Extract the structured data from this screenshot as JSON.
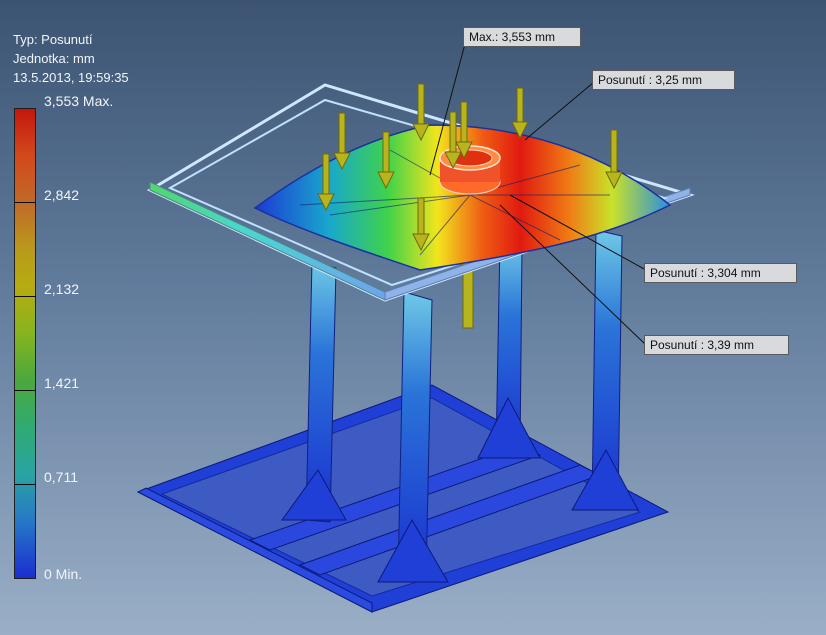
{
  "legend": {
    "type_line": "Typ: Posunutí",
    "unit_line": "Jednotka: mm",
    "timestamp": "13.5.2013, 19:59:35",
    "ticks": [
      "3,553 Max.",
      "2,842",
      "2,132",
      "1,421",
      "0,711",
      "0 Min."
    ],
    "gradient_colors": [
      "#c3170c",
      "#d2491b",
      "#b99a1c",
      "#4aa83e",
      "#2aa3a3",
      "#1b2ed0"
    ]
  },
  "callouts": {
    "max": "Max.: 3,553 mm",
    "probe1": "Posunutí : 3,25 mm",
    "probe2": "Posunutí : 3,304 mm",
    "probe3": "Posunutí : 3,39 mm"
  },
  "colors": {
    "background_top": "#3c5472",
    "background_bottom": "#9aafc7",
    "frame_blue": "#1f3fd6",
    "load_arrow": "#b8b41e"
  },
  "icons": [
    "load-arrow-icon"
  ]
}
